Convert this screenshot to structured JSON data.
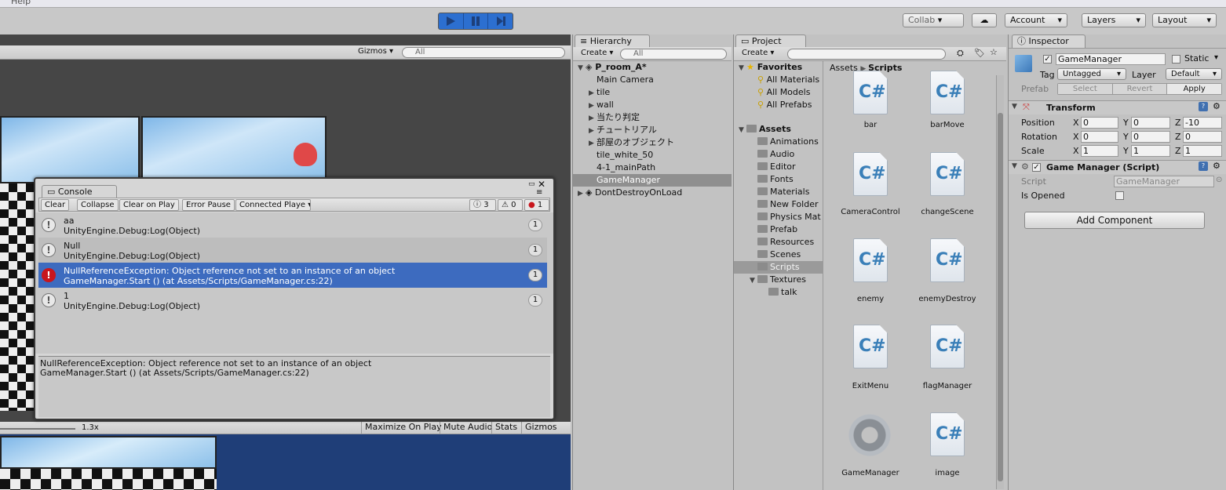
{
  "menubar": {
    "help": "Help"
  },
  "toolbar": {
    "collab": "Collab",
    "account": "Account",
    "layers": "Layers",
    "layout": "Layout"
  },
  "scene": {
    "gizmos": "Gizmos",
    "search_placeholder": "All"
  },
  "game": {
    "scale": "1.3x",
    "maximize": "Maximize On Play",
    "mute": "Mute Audio",
    "stats": "Stats",
    "gizmos": "Gizmos"
  },
  "hierarchy": {
    "tab": "Hierarchy",
    "create": "Create",
    "search_placeholder": "All",
    "scene_name": "P_room_A*",
    "items": [
      "Main Camera",
      "tile",
      "wall",
      "当たり判定",
      "チュートリアル",
      "部屋のオブジェクト",
      "tile_white_50",
      "4-1_mainPath",
      "GameManager"
    ],
    "dont_destroy": "DontDestroyOnLoad"
  },
  "project": {
    "tab": "Project",
    "create": "Create",
    "favorites": "Favorites",
    "fav_items": [
      "All Materials",
      "All Models",
      "All Prefabs"
    ],
    "assets": "Assets",
    "folders": [
      "Animations",
      "Audio",
      "Editor",
      "Fonts",
      "Materials",
      "New Folder",
      "Physics Mat",
      "Prefab",
      "Resources",
      "Scenes",
      "Scripts",
      "Textures"
    ],
    "subfolder": "talk",
    "breadcrumb_root": "Assets",
    "breadcrumb_current": "Scripts",
    "scripts": [
      "bar",
      "barMove",
      "CameraControl",
      "changeScene",
      "enemy",
      "enemyDestroy",
      "ExitMenu",
      "flagManager",
      "GameManager",
      "image"
    ]
  },
  "inspector": {
    "tab": "Inspector",
    "object_name": "GameManager",
    "static_label": "Static",
    "tag_label": "Tag",
    "tag_value": "Untagged",
    "layer_label": "Layer",
    "layer_value": "Default",
    "prefab_label": "Prefab",
    "prefab_select": "Select",
    "prefab_revert": "Revert",
    "prefab_apply": "Apply",
    "transform": "Transform",
    "position": "Position",
    "rotation": "Rotation",
    "scale": "Scale",
    "pos": [
      "0",
      "0",
      "-10"
    ],
    "rot": [
      "0",
      "0",
      "0"
    ],
    "scl": [
      "1",
      "1",
      "1"
    ],
    "x": "X",
    "y": "Y",
    "z": "Z",
    "component": "Game Manager (Script)",
    "script_label": "Script",
    "script_value": "GameManager",
    "is_opened": "Is Opened",
    "add_component": "Add Component"
  },
  "console": {
    "tab": "Console",
    "clear": "Clear",
    "collapse": "Collapse",
    "clear_on_play": "Clear on Play",
    "error_pause": "Error Pause",
    "connected": "Connected Playe",
    "log_count": "3",
    "warn_count": "0",
    "err_count": "1",
    "rows": [
      {
        "line1": "aa",
        "line2": "UnityEngine.Debug:Log(Object)",
        "count": "1"
      },
      {
        "line1": "Null",
        "line2": "UnityEngine.Debug:Log(Object)",
        "count": "1"
      },
      {
        "line1": "NullReferenceException: Object reference not set to an instance of an object",
        "line2": "GameManager.Start () (at Assets/Scripts/GameManager.cs:22)",
        "count": "1"
      },
      {
        "line1": "1",
        "line2": "UnityEngine.Debug:Log(Object)",
        "count": "1"
      }
    ],
    "detail1": "NullReferenceException: Object reference not set to an instance of an object",
    "detail2": "GameManager.Start () (at Assets/Scripts/GameManager.cs:22)"
  }
}
